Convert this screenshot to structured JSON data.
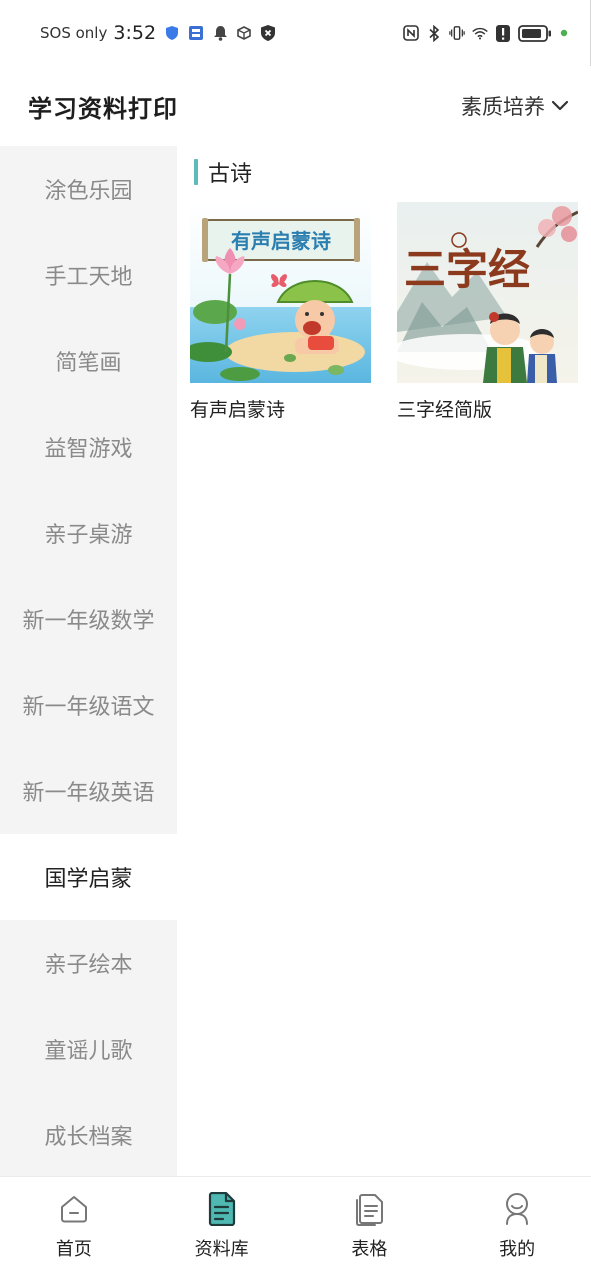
{
  "status_bar": {
    "carrier": "SOS only",
    "time": "3:52"
  },
  "header": {
    "title": "学习资料打印",
    "category": "素质培养"
  },
  "sidebar": {
    "items": [
      {
        "label": "涂色乐园"
      },
      {
        "label": "手工天地"
      },
      {
        "label": "简笔画"
      },
      {
        "label": "益智游戏"
      },
      {
        "label": "亲子桌游"
      },
      {
        "label": "新一年级数学"
      },
      {
        "label": "新一年级语文"
      },
      {
        "label": "新一年级英语"
      },
      {
        "label": "国学启蒙"
      },
      {
        "label": "亲子绘本"
      },
      {
        "label": "童谣儿歌"
      },
      {
        "label": "成长档案"
      }
    ],
    "active_index": 8
  },
  "content": {
    "section_title": "古诗",
    "cards": [
      {
        "title": "有声启蒙诗",
        "banner": "有声启蒙诗"
      },
      {
        "title": "三字经简版",
        "calligraphy": "三字经"
      }
    ]
  },
  "bottom_nav": {
    "items": [
      {
        "label": "首页",
        "icon": "home-icon"
      },
      {
        "label": "资料库",
        "icon": "document-icon"
      },
      {
        "label": "表格",
        "icon": "files-icon"
      },
      {
        "label": "我的",
        "icon": "profile-icon"
      }
    ],
    "active_index": 1
  },
  "colors": {
    "accent": "#5bbcb8",
    "active_nav_fill": "#4fb8b2",
    "sidebar_bg": "#f4f4f4",
    "sidebar_text": "#8a8a8a",
    "status_dot": "#4caf50"
  }
}
